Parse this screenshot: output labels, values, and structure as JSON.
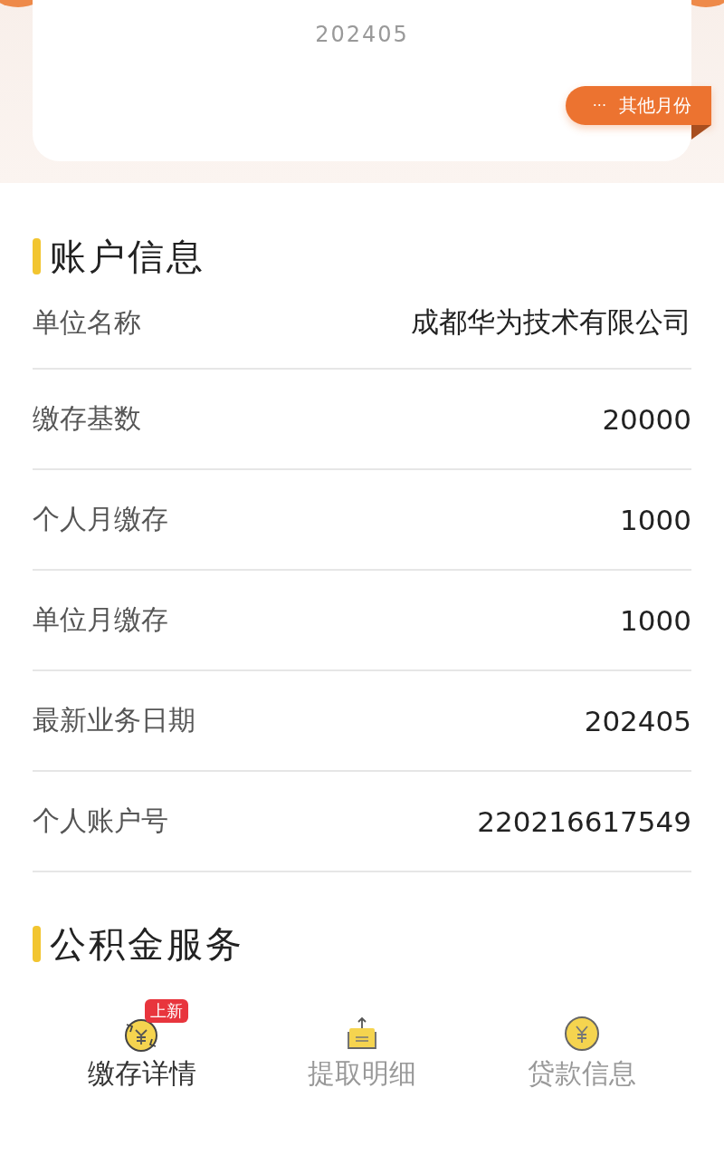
{
  "month_card": {
    "month": "202405",
    "other_months_button": {
      "icon": "···",
      "label": "其他月份"
    }
  },
  "account_info": {
    "title": "账户信息",
    "rows": [
      {
        "label": "单位名称",
        "value": "成都华为技术有限公司"
      },
      {
        "label": "缴存基数",
        "value": "20000"
      },
      {
        "label": "个人月缴存",
        "value": "1000"
      },
      {
        "label": "单位月缴存",
        "value": "1000"
      },
      {
        "label": "最新业务日期",
        "value": "202405"
      },
      {
        "label": "个人账户号",
        "value": "220216617549"
      }
    ]
  },
  "services": {
    "title": "公积金服务",
    "items": [
      {
        "kind": "deposit",
        "label": "缴存详情",
        "badge": "上新",
        "selected": true
      },
      {
        "kind": "withdraw",
        "label": "提取明细",
        "selected": false
      },
      {
        "kind": "loan",
        "label": "贷款信息",
        "selected": false
      }
    ]
  }
}
